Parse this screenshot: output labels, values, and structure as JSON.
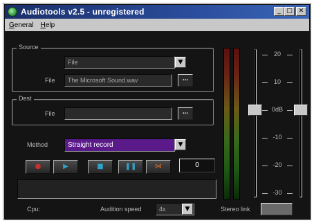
{
  "window": {
    "title": "Audiotools v2.5 - unregistered"
  },
  "menu": [
    "General",
    "Help"
  ],
  "source": {
    "group_label": "Source",
    "type_value": "File",
    "file_label": "File",
    "file_value": "The Microsoft Sound.wav",
    "browse_label": "..."
  },
  "dest": {
    "group_label": "Dest",
    "file_label": "File",
    "file_value": "",
    "browse_label": "..."
  },
  "method": {
    "label": "Method",
    "value": "Straight record"
  },
  "transport": {
    "record_icon": "record-icon",
    "play_icon": "play-icon",
    "stop_icon": "stop-icon",
    "pause_icon": "pause-icon",
    "mute_icon": "mute-icon",
    "zero_label": "0"
  },
  "bottom": {
    "cpu_label": "Cpu:",
    "audition_label": "Audition speed",
    "audition_value": "4x",
    "stereo_label": "Stereo link"
  },
  "fader": {
    "scale": [
      "20",
      "10",
      "0dB",
      "-10",
      "-20",
      "-30"
    ],
    "left_level_db": 0,
    "right_level_db": 0
  },
  "colors": {
    "method_bg": "#5a1a8a",
    "title_bar": "#1a2f6a"
  }
}
